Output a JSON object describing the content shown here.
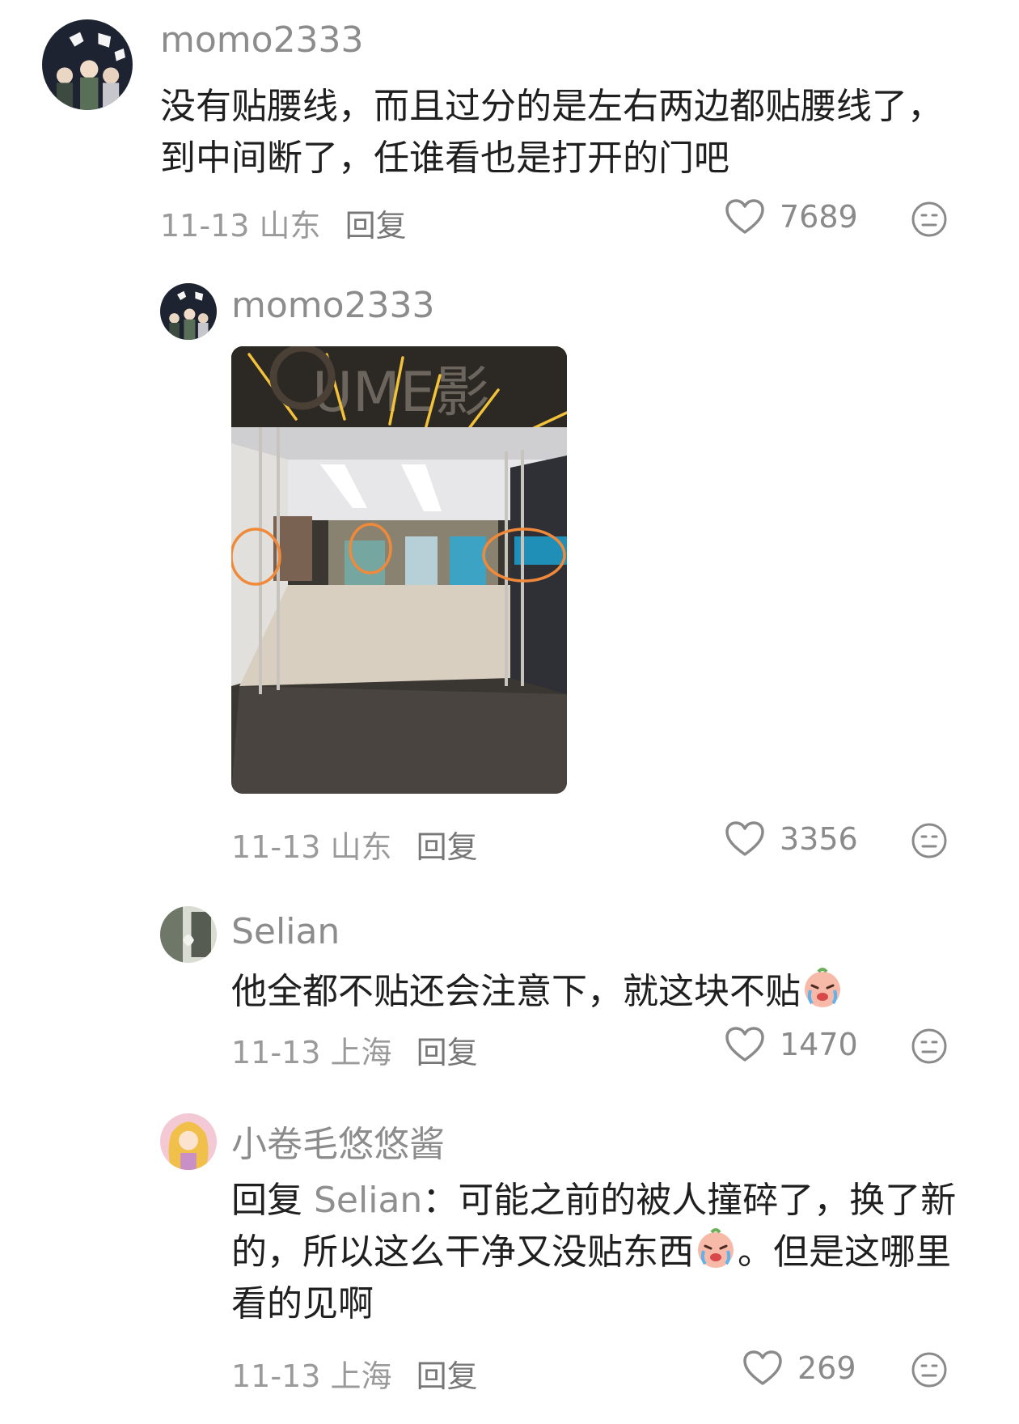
{
  "comments": [
    {
      "username": "momo2333",
      "text": "没有贴腰线，而且过分的是左右两边都贴腰线了，到中间断了，任谁看也是打开的门吧",
      "date": "11-13",
      "location": "山东",
      "reply_label": "回复",
      "likes": "7689",
      "avatar_icon": "user-avatar-icon"
    },
    {
      "username": "momo2333",
      "date": "11-13",
      "location": "山东",
      "reply_label": "回复",
      "likes": "3356",
      "image_text": "UME影",
      "avatar_icon": "user-avatar-icon"
    },
    {
      "username": "Selian",
      "text": "他全都不贴还会注意下，就这块不贴",
      "emoji": "crying-face-emoji",
      "date": "11-13",
      "location": "上海",
      "reply_label": "回复",
      "likes": "1470",
      "avatar_icon": "user-avatar-icon"
    },
    {
      "username": "小卷毛悠悠酱",
      "reply_prefix": "回复",
      "reply_to": "Selian",
      "colon": "：",
      "text_before_emoji": "可能之前的被人撞碎了，换了新的，所以这么干净又没贴东西",
      "text_after_emoji": "。但是这哪里看的见啊",
      "emoji": "crying-face-emoji",
      "date": "11-13",
      "location": "上海",
      "reply_label": "回复",
      "likes": "269",
      "avatar_icon": "user-avatar-icon"
    }
  ],
  "icons": {
    "like": "heart-outline-icon",
    "react": "neutral-face-icon"
  },
  "colors": {
    "username": "#8c8c8c",
    "meta": "#9a9a9a",
    "text": "#1f1f1f",
    "icon": "#8a8a8a"
  }
}
